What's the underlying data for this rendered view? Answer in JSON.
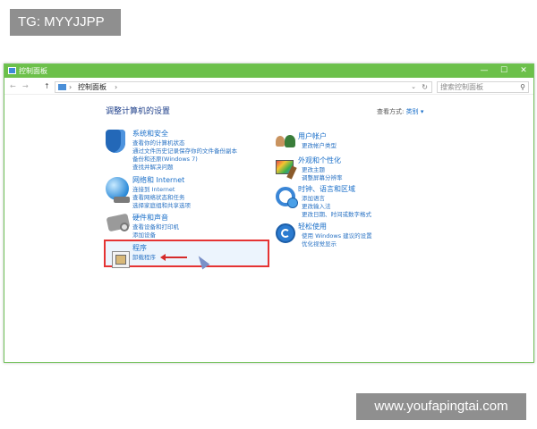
{
  "overlay": {
    "top_left_badge": "TG: MYYJJPP",
    "bottom_right_badge": "www.youfapingtai.com"
  },
  "window": {
    "title": "控制面板",
    "controls": {
      "minimize": "—",
      "maximize": "☐",
      "close": "✕"
    }
  },
  "addressbar": {
    "back": "←",
    "forward": "→",
    "up": "↑",
    "path": "控制面板",
    "separator": "›",
    "dropdown": "⌄",
    "refresh": "↻",
    "search_placeholder": "搜索控制面板",
    "search_icon": "⚲"
  },
  "content": {
    "heading": "调整计算机的设置",
    "view_by_label": "查看方式:",
    "view_by_value": "类别 ▾"
  },
  "categories": {
    "security": {
      "title": "系统和安全",
      "links": [
        "查看你的计算机状态",
        "通过文件历史记录保存你的文件备份副本",
        "备份和还原(Windows 7)",
        "查找并解决问题"
      ]
    },
    "network": {
      "title": "网络和 Internet",
      "links": [
        "连接到 Internet",
        "查看网络状态和任务",
        "选择家庭组和共享选项"
      ]
    },
    "hardware": {
      "title": "硬件和声音",
      "links": [
        "查看设备和打印机",
        "添加设备"
      ]
    },
    "programs": {
      "title": "程序",
      "links": [
        "卸载程序"
      ]
    },
    "users": {
      "title": "用户帐户",
      "links": [
        "更改帐户类型"
      ]
    },
    "appearance": {
      "title": "外观和个性化",
      "links": [
        "更改主题",
        "调整屏幕分辨率"
      ]
    },
    "clock": {
      "title": "时钟、语言和区域",
      "links": [
        "添加语言",
        "更改输入法",
        "更改日期、时间或数字格式"
      ]
    },
    "ease": {
      "title": "轻松使用",
      "links": [
        "使用 Windows 建议的设置",
        "优化视觉显示"
      ]
    }
  },
  "colors": {
    "titlebar": "#6cc04a",
    "link": "#2a73c4",
    "category_title": "#1a6fc9",
    "highlight_border": "#e53333"
  }
}
